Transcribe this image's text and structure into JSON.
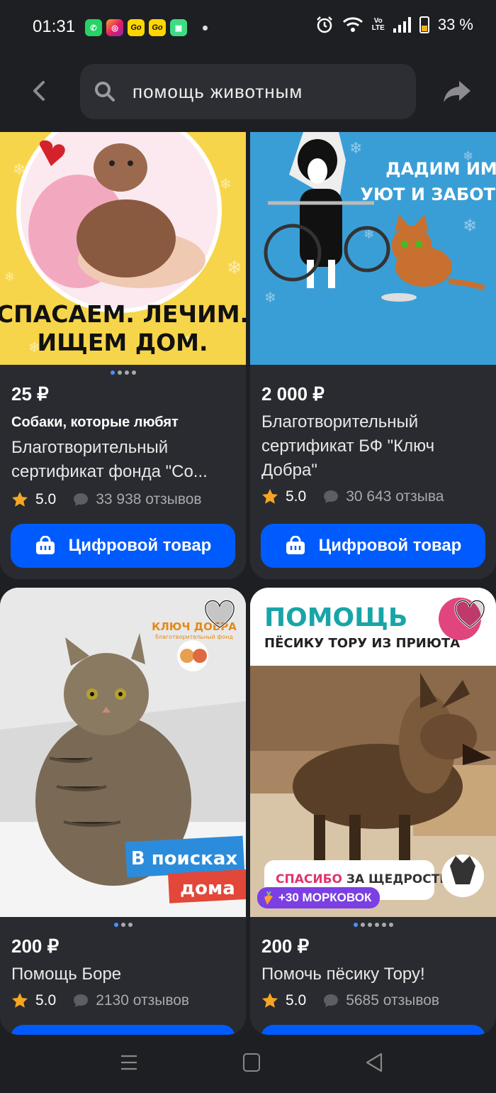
{
  "status": {
    "time": "01:31",
    "battery": "33 %",
    "lte_top": "Vo",
    "lte_bottom": "LTE"
  },
  "search": {
    "query": "помощь животным"
  },
  "products": [
    {
      "price": "25 ₽",
      "brand": "Собаки, которые любят",
      "title_line1": "Благотворительный",
      "title_line2": "сертификат фонда \"Со...",
      "score": "5.0",
      "reviews": "33 938 отзывов",
      "button": "Цифровой товар",
      "image_caption_1": "СПАСАЕМ. ЛЕЧИМ.",
      "image_caption_2": "ИЩЕМ ДОМ."
    },
    {
      "price": "2 000 ₽",
      "title_line1": "Благотворительный",
      "title_line2": "сертификат БФ \"Ключ",
      "title_line3": "Добра\"",
      "score": "5.0",
      "reviews": "30 643 отзыва",
      "button": "Цифровой товар",
      "image_caption_1": "ДАДИМ ИМ",
      "image_caption_2": "УЮТ И ЗАБОТУ"
    },
    {
      "price": "200 ₽",
      "title": "Помощь Боре",
      "score": "5.0",
      "reviews": "2130 отзывов",
      "image_logo": "КЛЮЧ ДОБРА",
      "image_logo_sub": "благотворительный фонд",
      "image_tag_1": "В поисках",
      "image_tag_2": "дома"
    },
    {
      "price": "200 ₽",
      "title": "Помочь пёсику Тору!",
      "score": "5.0",
      "reviews": "5685 отзывов",
      "image_caption_1": "ПОМОЩЬ",
      "image_caption_2": "ПЁСИКУ ТОРУ ИЗ ПРИЮТА",
      "image_caption_3a": "СПАСИБО",
      "image_caption_3b": " ЗА ЩЕДРОСТЬ,",
      "bonus": "+30 МОРКОВОК"
    }
  ],
  "colors": {
    "background": "#1e1f23",
    "card": "#2a2b30",
    "accent": "#005bff",
    "star": "#f5a623"
  }
}
